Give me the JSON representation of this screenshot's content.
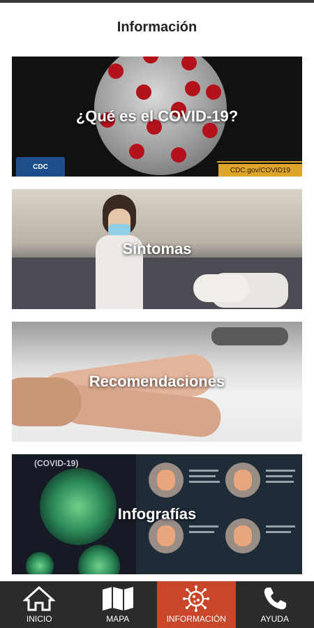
{
  "header": {
    "title": "Información"
  },
  "cards": [
    {
      "label": "¿Qué es el COVID-19?",
      "badge": "CDC",
      "url": "CDC.gov/COVID19"
    },
    {
      "label": "Síntomas"
    },
    {
      "label": "Recomendaciones"
    },
    {
      "label": "Infografías",
      "tag": "(COVID-19)"
    }
  ],
  "nav": {
    "items": [
      {
        "label": "INICIO",
        "icon": "home-icon"
      },
      {
        "label": "MAPA",
        "icon": "map-icon"
      },
      {
        "label": "INFORMACIÓN",
        "icon": "virus-icon",
        "active": true
      },
      {
        "label": "AYUDA",
        "icon": "phone-icon"
      }
    ]
  },
  "colors": {
    "active_tab": "#c8472a",
    "nav_bg": "#2b2b2b",
    "header_text": "#222222"
  }
}
